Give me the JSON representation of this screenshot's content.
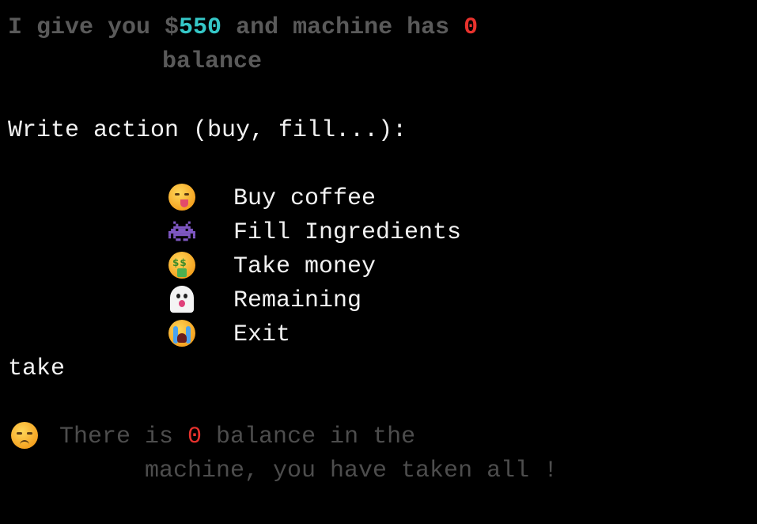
{
  "header": {
    "text_before_amount": "I give you $",
    "amount": "550",
    "text_middle": " and machine has ",
    "machine_amount": "0",
    "text_wrap": "balance"
  },
  "prompt": {
    "label": "Write action (buy, fill...):"
  },
  "menu": {
    "items": [
      {
        "icon": "yum-face-icon",
        "label": "Buy coffee"
      },
      {
        "icon": "space-invader-icon",
        "label": "Fill Ingredients"
      },
      {
        "icon": "money-mouth-face-icon",
        "label": "Take money"
      },
      {
        "icon": "ghost-icon",
        "label": "Remaining"
      },
      {
        "icon": "loudly-crying-face-icon",
        "label": "Exit"
      }
    ]
  },
  "input": {
    "value": "take"
  },
  "message": {
    "icon": "pensive-face-icon",
    "text_before": "There is ",
    "amount": "0",
    "text_after": " balance in the",
    "text_wrap": "machine, you have taken all !"
  },
  "colors": {
    "background": "#000000",
    "accent_cyan": "#35c7c7",
    "accent_red": "#e8322d",
    "dim_gray": "#5a5a5a"
  }
}
